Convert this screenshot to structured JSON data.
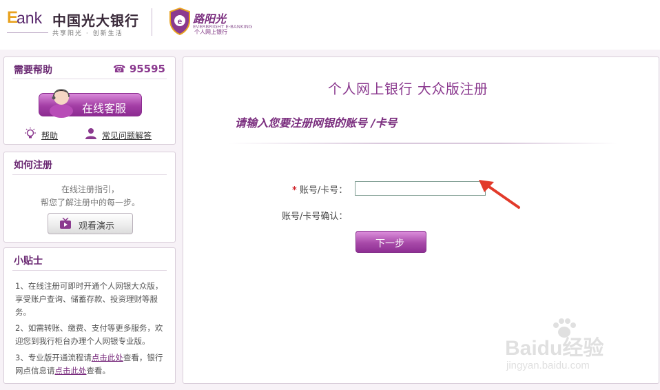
{
  "header": {
    "bank_e": "E",
    "bank_word": "ank",
    "bank_name": "中国光大银行",
    "slogan": "共享阳光 · 创新生活",
    "luyangguang_name": "路阳光",
    "luyangguang_sub": "EVERBRIGHT E-BANKING",
    "luyangguang_sub2": "个人网上银行"
  },
  "help": {
    "title": "需要帮助",
    "phone": "95595",
    "online_service": "在线客服",
    "help_link": "帮助",
    "faq_link": "常见问题解答"
  },
  "register_howto": {
    "title": "如何注册",
    "line1": "在线注册指引，",
    "line2": "帮您了解注册中的每一步。",
    "watch_demo": "观看演示"
  },
  "tips": {
    "title": "小贴士",
    "tip1": "1、在线注册可即时开通个人网银大众版，享受账户查询、储蓄存款、投资理财等服务。",
    "tip2": "2、如需转账、缴费、支付等更多服务，欢迎您到我行柜台办理个人网银专业版。",
    "tip3_a": "3、专业版开通流程请",
    "tip3_link1": "点击此处",
    "tip3_b": "查看，银行网点信息请",
    "tip3_link2": "点击此处",
    "tip3_c": "查看。"
  },
  "main": {
    "title": "个人网上银行 大众版注册",
    "subtitle": "请输入您要注册网银的账号 /卡号",
    "required_mark": "*",
    "account_label": "账号/卡号：",
    "confirm_label": "账号/卡号确认：",
    "account_value": "",
    "next_button": "下一步"
  },
  "watermark": {
    "text": "Baidu经验",
    "url": "jingyan.baidu.com"
  },
  "colors": {
    "brand_purple": "#7a2d7e",
    "accent_red": "#d0232a",
    "background": "#f7f2f7"
  },
  "icons": [
    "phone-icon",
    "lightbulb-icon",
    "user-icon",
    "tv-icon",
    "arrow-annotation"
  ]
}
